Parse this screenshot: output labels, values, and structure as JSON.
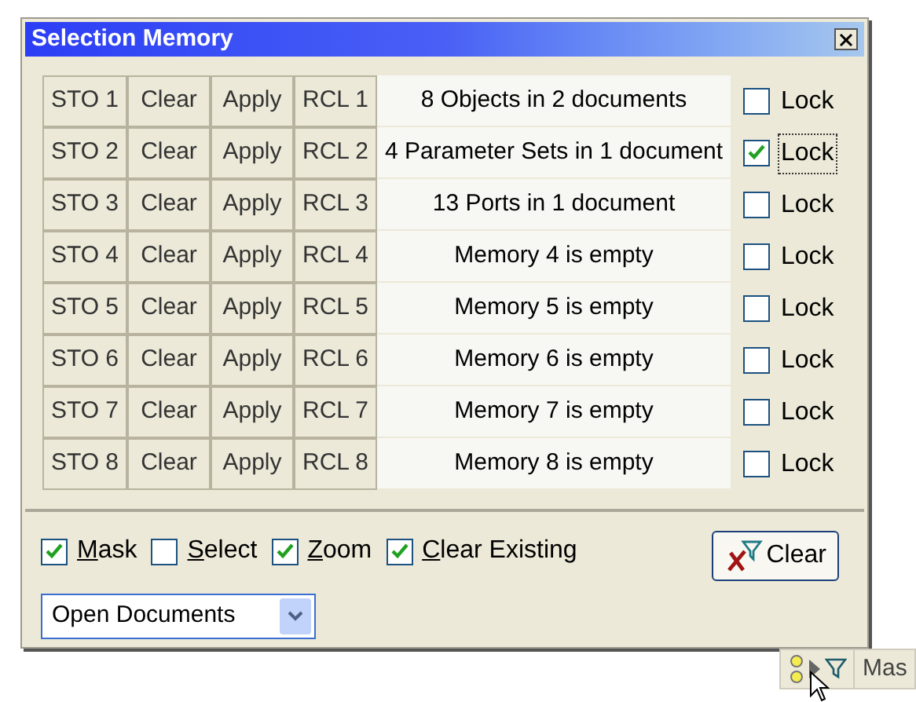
{
  "window": {
    "title": "Selection Memory"
  },
  "memories": [
    {
      "store": "STO 1",
      "clear": "Clear",
      "apply": "Apply",
      "recall": "RCL 1",
      "description": "8 Objects in 2 documents",
      "lock": {
        "label": "Lock",
        "checked": false,
        "focused": false
      }
    },
    {
      "store": "STO 2",
      "clear": "Clear",
      "apply": "Apply",
      "recall": "RCL 2",
      "description": "4 Parameter Sets in 1 document",
      "lock": {
        "label": "Lock",
        "checked": true,
        "focused": true
      }
    },
    {
      "store": "STO 3",
      "clear": "Clear",
      "apply": "Apply",
      "recall": "RCL 3",
      "description": "13 Ports in 1 document",
      "lock": {
        "label": "Lock",
        "checked": false,
        "focused": false
      }
    },
    {
      "store": "STO 4",
      "clear": "Clear",
      "apply": "Apply",
      "recall": "RCL 4",
      "description": "Memory 4 is empty",
      "lock": {
        "label": "Lock",
        "checked": false,
        "focused": false
      }
    },
    {
      "store": "STO 5",
      "clear": "Clear",
      "apply": "Apply",
      "recall": "RCL 5",
      "description": "Memory 5 is empty",
      "lock": {
        "label": "Lock",
        "checked": false,
        "focused": false
      }
    },
    {
      "store": "STO 6",
      "clear": "Clear",
      "apply": "Apply",
      "recall": "RCL 6",
      "description": "Memory 6 is empty",
      "lock": {
        "label": "Lock",
        "checked": false,
        "focused": false
      }
    },
    {
      "store": "STO 7",
      "clear": "Clear",
      "apply": "Apply",
      "recall": "RCL 7",
      "description": "Memory 7 is empty",
      "lock": {
        "label": "Lock",
        "checked": false,
        "focused": false
      }
    },
    {
      "store": "STO 8",
      "clear": "Clear",
      "apply": "Apply",
      "recall": "RCL 8",
      "description": "Memory 8 is empty",
      "lock": {
        "label": "Lock",
        "checked": false,
        "focused": false
      }
    }
  ],
  "options": [
    {
      "label": "Mask",
      "checked": true
    },
    {
      "label": "Select",
      "checked": false
    },
    {
      "label": "Zoom",
      "checked": true
    },
    {
      "label": "Clear Existing",
      "checked": true
    }
  ],
  "clear_button": "Clear",
  "scope_dropdown": {
    "value": "Open Documents"
  },
  "status_bar": {
    "text": "Mas"
  }
}
